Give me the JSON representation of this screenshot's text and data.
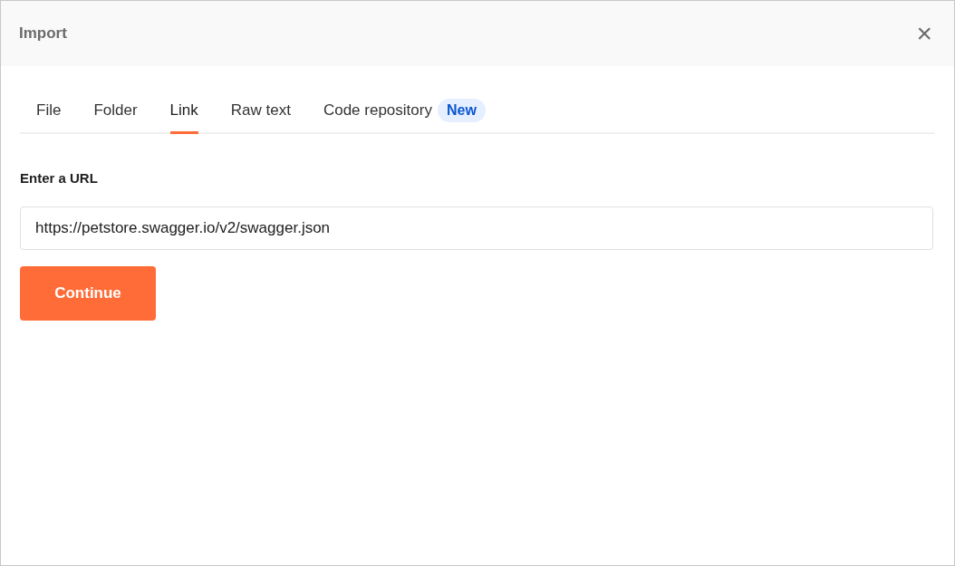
{
  "dialog": {
    "title": "Import",
    "close": "×"
  },
  "tabs": [
    {
      "label": "File",
      "selected": false
    },
    {
      "label": "Folder",
      "selected": false
    },
    {
      "label": "Link",
      "selected": true
    },
    {
      "label": "Raw text",
      "selected": false
    },
    {
      "label": "Code repository",
      "selected": false,
      "badge": "New"
    }
  ],
  "url_field": {
    "label": "Enter a URL",
    "value": "https://petstore.swagger.io/v2/swagger.json"
  },
  "buttons": [
    "Continue"
  ]
}
